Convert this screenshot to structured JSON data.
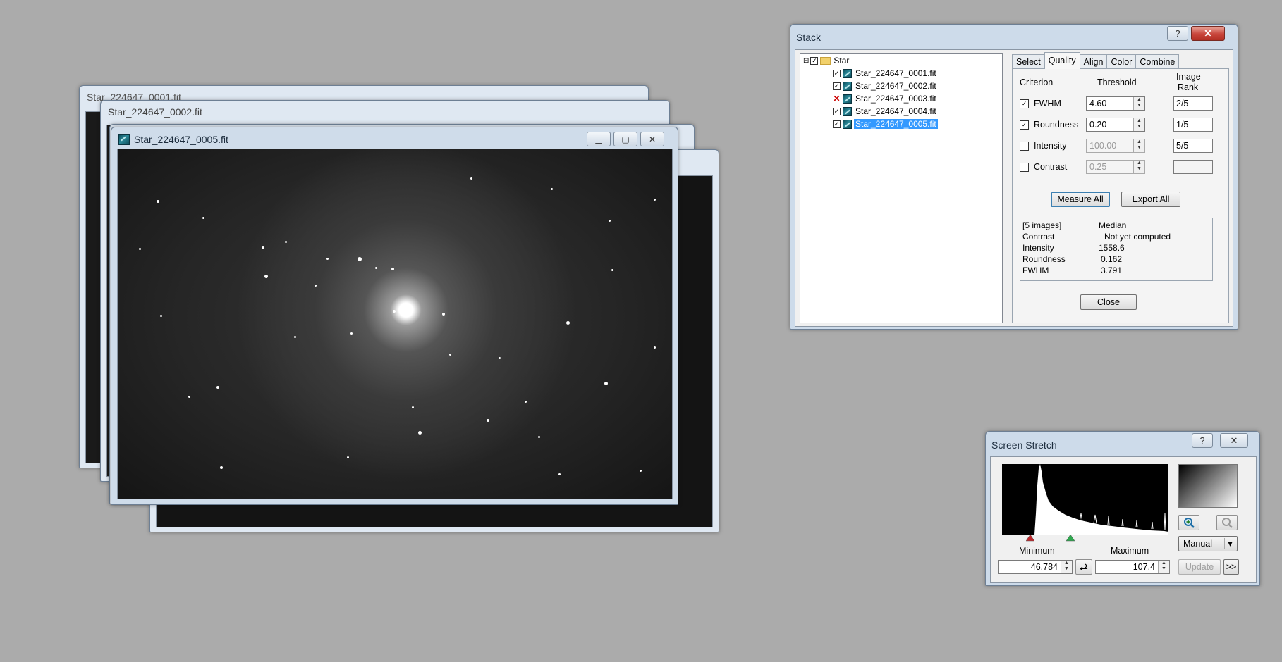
{
  "image_windows": [
    {
      "title": "Star_224647_0001.fit"
    },
    {
      "title": "Star_224647_0002.fit"
    },
    {
      "title": ""
    },
    {
      "title": ""
    },
    {
      "title": "Star_224647_0005.fit",
      "controls": {
        "minimize": "▁",
        "maximize": "▢",
        "close": "✕"
      }
    }
  ],
  "stack": {
    "title": "Stack",
    "help": "?",
    "close": "✕",
    "tree": {
      "expander": "⊟",
      "root": "Star",
      "files": [
        {
          "name": "Star_224647_0001.fit",
          "state": "✓"
        },
        {
          "name": "Star_224647_0002.fit",
          "state": "✓"
        },
        {
          "name": "Star_224647_0003.fit",
          "state": "✕"
        },
        {
          "name": "Star_224647_0004.fit",
          "state": "✓"
        },
        {
          "name": "Star_224647_0005.fit",
          "state": "✓"
        }
      ]
    },
    "tabs": [
      "Select",
      "Quality",
      "Align",
      "Color",
      "Combine"
    ],
    "active_tab": "Quality",
    "headers": {
      "criterion": "Criterion",
      "threshold": "Threshold",
      "rank_line1": "Image",
      "rank_line2": "Rank"
    },
    "criteria": [
      {
        "label": "FWHM",
        "checked": "✓",
        "threshold": "4.60",
        "rank": "2/5"
      },
      {
        "label": "Roundness",
        "checked": "✓",
        "threshold": "0.20",
        "rank": "1/5"
      },
      {
        "label": "Intensity",
        "checked": "",
        "threshold": "100.00",
        "rank": "5/5"
      },
      {
        "label": "Contrast",
        "checked": "",
        "threshold": "0.25",
        "rank": ""
      }
    ],
    "spin_arrows": "▲\n▼",
    "measure_all": "Measure All",
    "export_all": "Export All",
    "stats": {
      "header_left": "[5 images]",
      "header_right": "Median",
      "rows": [
        {
          "label": "Contrast",
          "value": "Not yet computed"
        },
        {
          "label": "Intensity",
          "value": "1558.6"
        },
        {
          "label": "Roundness",
          "value": "0.162"
        },
        {
          "label": "FWHM",
          "value": "3.791"
        }
      ]
    },
    "close_button": "Close"
  },
  "screen_stretch": {
    "title": "Screen Stretch",
    "help": "?",
    "close": "✕",
    "minimum_label": "Minimum",
    "maximum_label": "Maximum",
    "minimum_value": "46.784",
    "maximum_value": "107.4",
    "swap": "⇄",
    "mode": "Manual",
    "dropdown": "▾",
    "update": "Update",
    "more": ">>",
    "icons": [
      "zoom-in-icon",
      "zoom-out-icon"
    ],
    "colors": {
      "min_marker": "#c0282d",
      "max_marker": "#2fa84f"
    }
  }
}
